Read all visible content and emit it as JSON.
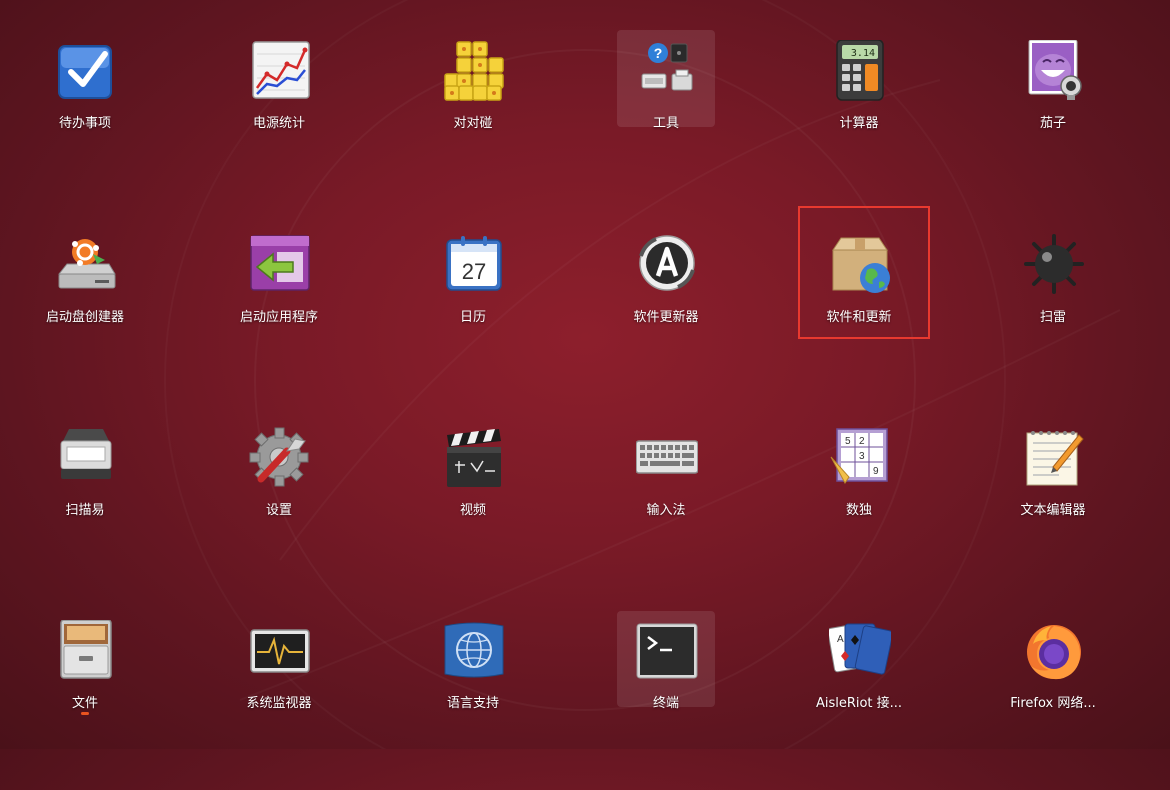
{
  "apps": [
    {
      "label": "待办事项",
      "icon": "todo-check-icon"
    },
    {
      "label": "电源统计",
      "icon": "power-statistics-chart-icon"
    },
    {
      "label": "对对碰",
      "icon": "swell-foop-blocks-icon"
    },
    {
      "label": "工具",
      "icon": "utilities-folder-icon"
    },
    {
      "label": "计算器",
      "icon": "calculator-icon"
    },
    {
      "label": "茄子",
      "icon": "cheese-webcam-icon"
    },
    {
      "label": "启动盘创建器",
      "icon": "startup-disk-creator-icon"
    },
    {
      "label": "启动应用程序",
      "icon": "startup-applications-icon"
    },
    {
      "label": "日历",
      "icon": "calendar-icon",
      "badge": "27"
    },
    {
      "label": "软件更新器",
      "icon": "software-updater-icon"
    },
    {
      "label": "软件和更新",
      "icon": "software-properties-package-icon"
    },
    {
      "label": "扫雷",
      "icon": "mines-icon"
    },
    {
      "label": "扫描易",
      "icon": "scanner-icon"
    },
    {
      "label": "设置",
      "icon": "settings-gear-icon"
    },
    {
      "label": "视频",
      "icon": "video-clapperboard-icon"
    },
    {
      "label": "输入法",
      "icon": "keyboard-input-method-icon"
    },
    {
      "label": "数独",
      "icon": "sudoku-icon"
    },
    {
      "label": "文本编辑器",
      "icon": "text-editor-icon"
    },
    {
      "label": "文件",
      "icon": "files-cabinet-icon"
    },
    {
      "label": "系统监视器",
      "icon": "system-monitor-icon"
    },
    {
      "label": "语言支持",
      "icon": "language-support-icon"
    },
    {
      "label": "终端",
      "icon": "terminal-icon"
    },
    {
      "label": "AisleRiot 接...",
      "icon": "aisleriot-cards-icon"
    },
    {
      "label": "Firefox 网络...",
      "icon": "firefox-icon"
    }
  ],
  "calculator_display": "3.14",
  "colors": {
    "highlight": "#e8392f",
    "running_indicator": "#e95420",
    "background": "#7a1a27"
  }
}
